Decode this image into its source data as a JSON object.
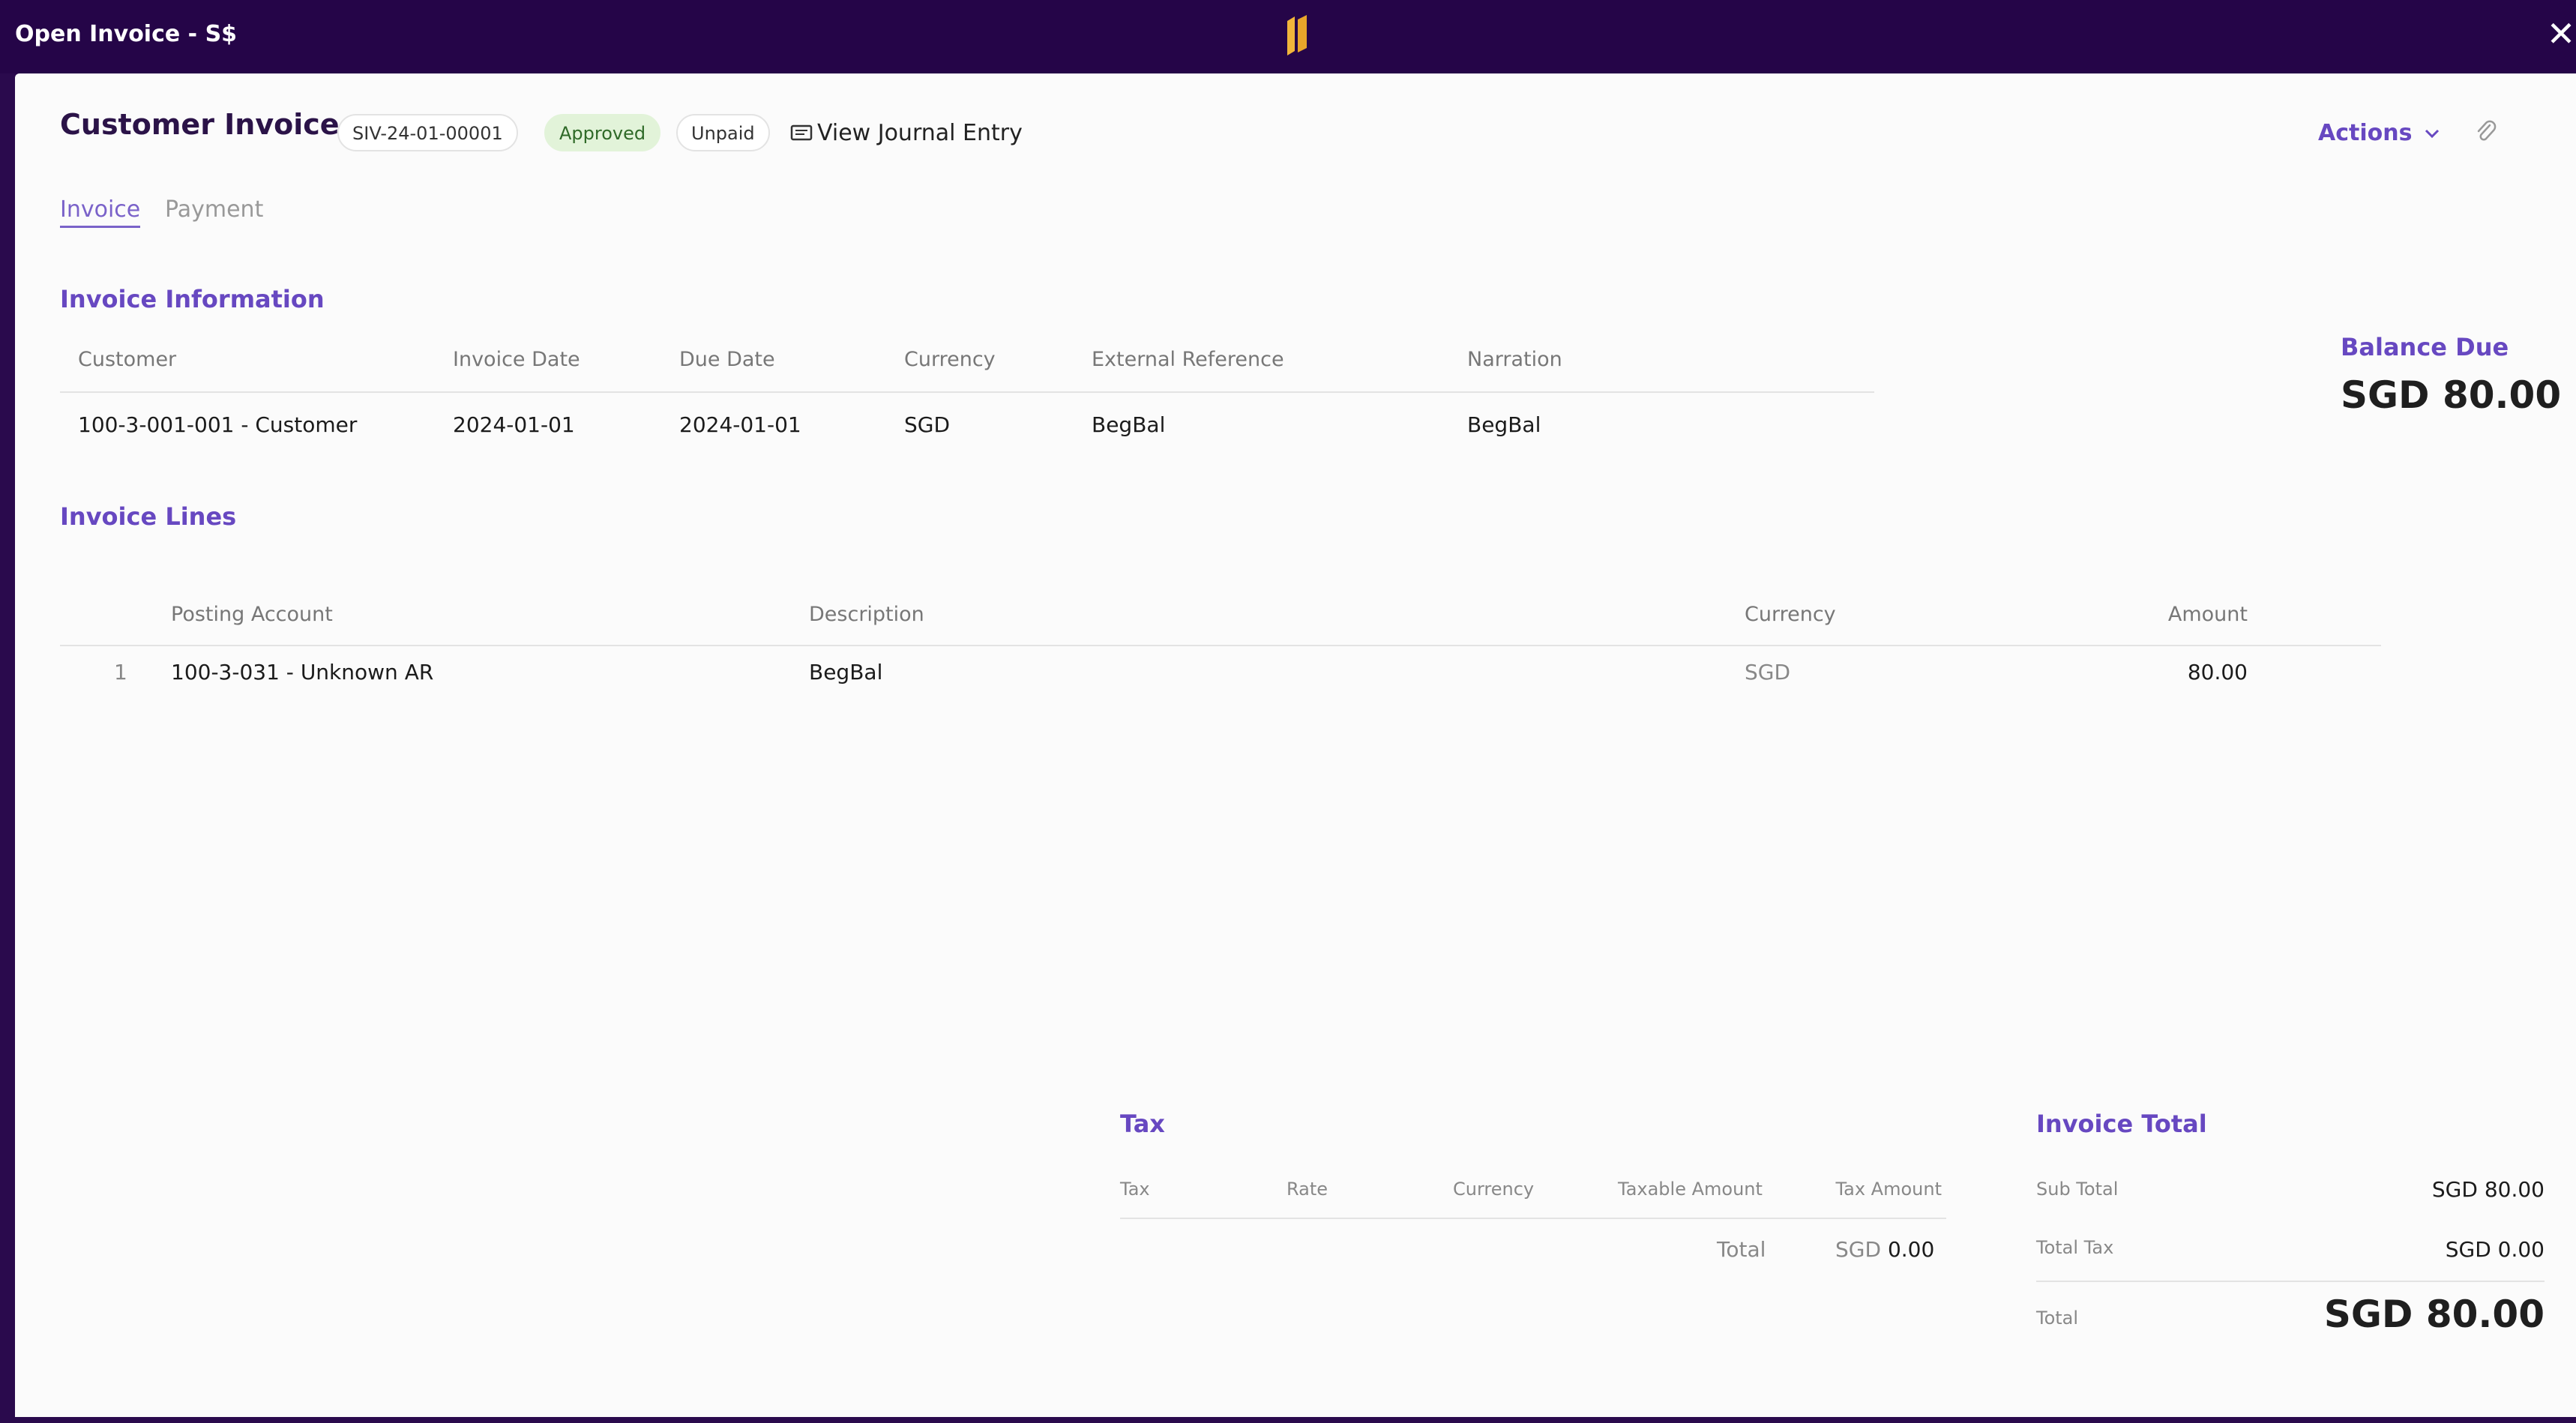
{
  "window": {
    "title": "Open Invoice - S$",
    "logo_icon": "brand-logo-icon",
    "close_glyph": "✕"
  },
  "header": {
    "title": "Customer Invoice",
    "invoice_number": "SIV-24-01-00001",
    "status_approved": "Approved",
    "status_payment": "Unpaid",
    "view_journal_label": "View Journal Entry",
    "actions_label": "Actions",
    "attach_icon": "paperclip-icon"
  },
  "tabs": [
    {
      "label": "Invoice",
      "active": true
    },
    {
      "label": "Payment",
      "active": false
    }
  ],
  "invoice_info": {
    "title": "Invoice Information",
    "columns": [
      "Customer",
      "Invoice Date",
      "Due Date",
      "Currency",
      "External Reference",
      "Narration"
    ],
    "row": [
      "100-3-001-001 - Customer",
      "2024-01-01",
      "2024-01-01",
      "SGD",
      "BegBal",
      "BegBal"
    ]
  },
  "balance": {
    "label": "Balance Due",
    "amount": "SGD 80.00"
  },
  "invoice_lines": {
    "title": "Invoice Lines",
    "columns": [
      "Posting Account",
      "Description",
      "Currency",
      "Amount"
    ],
    "rows": [
      {
        "index": "1",
        "account": "100-3-031 - Unknown AR",
        "description": "BegBal",
        "currency": "SGD",
        "amount": "80.00"
      }
    ]
  },
  "tax": {
    "title": "Tax",
    "columns": [
      "Tax",
      "Rate",
      "Currency",
      "Taxable Amount",
      "Tax Amount"
    ],
    "total_label": "Total",
    "total_currency": "SGD",
    "total_value": "0.00"
  },
  "invoice_total": {
    "title": "Invoice Total",
    "subtotal_label": "Sub Total",
    "subtotal_value": "SGD 80.00",
    "total_tax_label": "Total Tax",
    "total_tax_value": "SGD 0.00",
    "total_label": "Total",
    "total_value": "SGD 80.00"
  },
  "colors": {
    "title_bar": "#250548",
    "accent": "#6748c1",
    "approved_bg": "#e2f3d9",
    "logo": "#f1b53b"
  }
}
